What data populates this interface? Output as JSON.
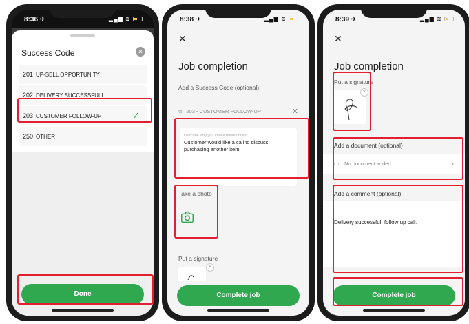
{
  "phone1": {
    "status": {
      "time": "8:36 ✈︎",
      "icons": "▂▄▆ ≋"
    },
    "sheet_title": "Success Code",
    "codes": [
      {
        "num": "201",
        "label": "UP-SELL OPPORTUNITY",
        "selected": false
      },
      {
        "num": "202",
        "label": "DELIVERY SUCCESSFULL",
        "selected": false
      },
      {
        "num": "203",
        "label": "CUSTOMER FOLLOW-UP",
        "selected": true
      },
      {
        "num": "250",
        "label": "OTHER",
        "selected": false
      }
    ],
    "done_label": "Done"
  },
  "phone2": {
    "status": {
      "time": "8:38 ✈︎",
      "icons": "▂▄▆ ≋"
    },
    "title": "Job completion",
    "success_code_label": "Add a Success Code (optional)",
    "selected_code": "203 - CUSTOMER FOLLOW-UP",
    "comment_placeholder": "Describe why you chose these codes",
    "comment_text": "Customer would like a call to discuss purchasing another item.",
    "photo_label": "Take a photo",
    "signature_label": "Put a signature",
    "complete_label": "Complete job"
  },
  "phone3": {
    "status": {
      "time": "8:39 ✈︎",
      "icons": "▂▄▆ ≋"
    },
    "title": "Job completion",
    "signature_label": "Put a signature",
    "document_label": "Add a document (optional)",
    "no_document": "No document added",
    "comment_label": "Add a comment (optional)",
    "comment_text": "Delivery successful, follow up call.",
    "complete_label": "Complete job"
  },
  "colors": {
    "accent": "#2fa84f",
    "highlight": "#e0202e",
    "check": "#2fa84f"
  },
  "icons": [
    "close-icon",
    "camera-icon",
    "chevron-right-icon",
    "document-icon",
    "check-icon",
    "tag-icon"
  ]
}
